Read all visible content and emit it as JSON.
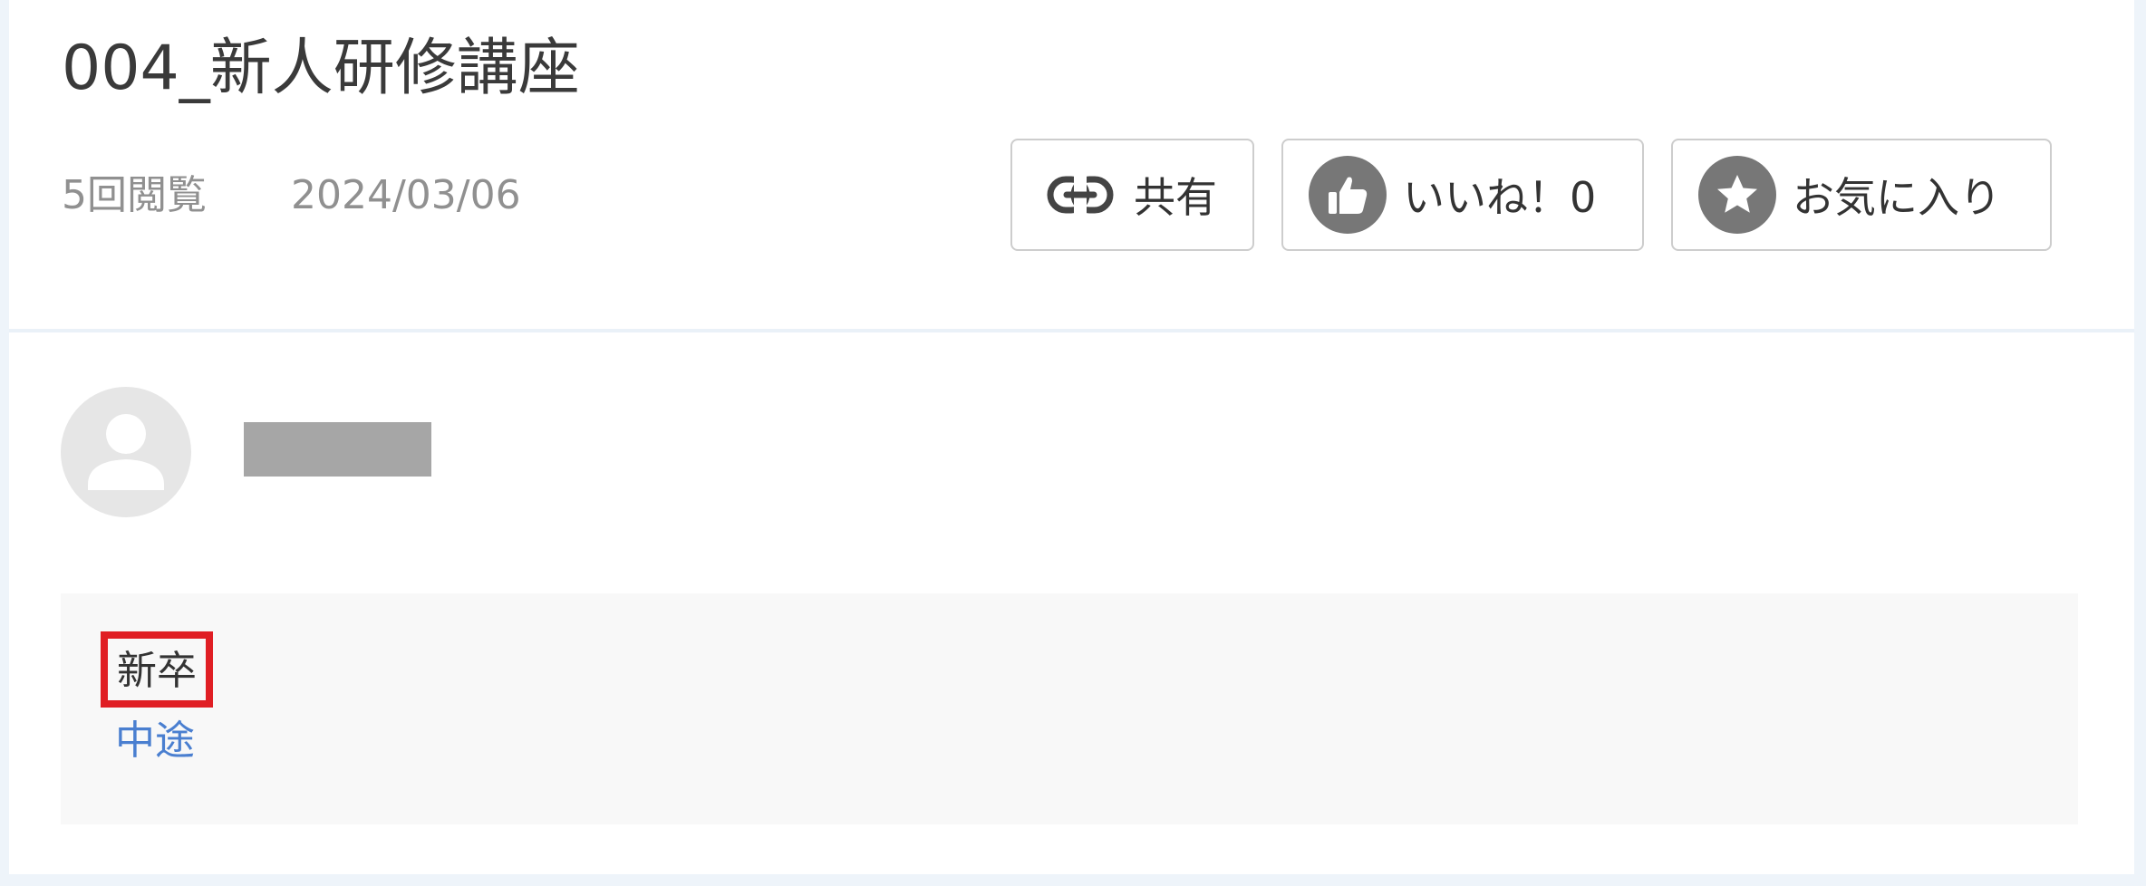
{
  "header": {
    "title": "004_新人研修講座",
    "views": "5回閲覧",
    "date": "2024/03/06"
  },
  "actions": {
    "share_label": "共有",
    "like_label": "いいね！0",
    "favorite_label": "お気に入り"
  },
  "tags": {
    "selected": "新卒",
    "other": "中途"
  },
  "colors": {
    "page_background": "#eef4fa",
    "icon_gray": "#777777",
    "highlight_red": "#e01e24",
    "link_blue": "#4a7fd0"
  },
  "icons": {
    "share": "link-icon",
    "like": "thumbs-up-icon",
    "favorite": "star-icon",
    "avatar": "user-icon"
  }
}
